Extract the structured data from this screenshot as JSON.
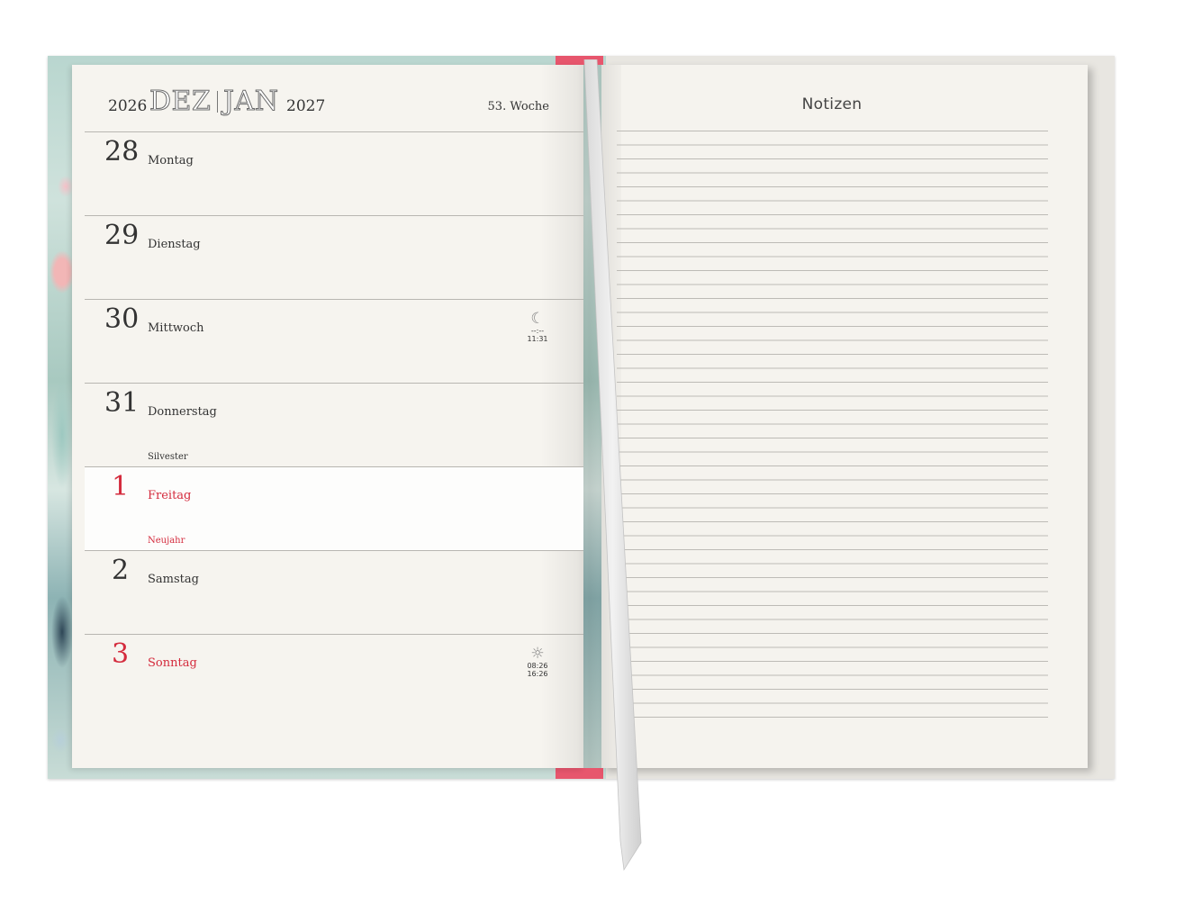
{
  "header": {
    "year_start": "2026",
    "month_start": "DEZ",
    "month_end": "JAN",
    "year_end": "2027",
    "week": "53. Woche"
  },
  "days": [
    {
      "num": "28",
      "name": "Montag",
      "note": "",
      "red": false
    },
    {
      "num": "29",
      "name": "Dienstag",
      "note": "",
      "red": false
    },
    {
      "num": "30",
      "name": "Mittwoch",
      "note": "",
      "red": false,
      "astro": {
        "symbol": "moon-icon",
        "line1": "--:--",
        "line2": "11:31"
      }
    },
    {
      "num": "31",
      "name": "Donnerstag",
      "note": "Silvester",
      "red": false
    },
    {
      "num": "1",
      "name": "Freitag",
      "note": "Neujahr",
      "red": true
    },
    {
      "num": "2",
      "name": "Samstag",
      "note": "",
      "red": false
    },
    {
      "num": "3",
      "name": "Sonntag",
      "note": "",
      "red": true,
      "astro": {
        "symbol": "sun-icon",
        "line1": "08:26",
        "line2": "16:26"
      }
    }
  ],
  "notes": {
    "title": "Notizen"
  },
  "colors": {
    "accent_red": "#d42b3d",
    "spine_band": "#e7566d",
    "page": "#f6f4ef"
  }
}
